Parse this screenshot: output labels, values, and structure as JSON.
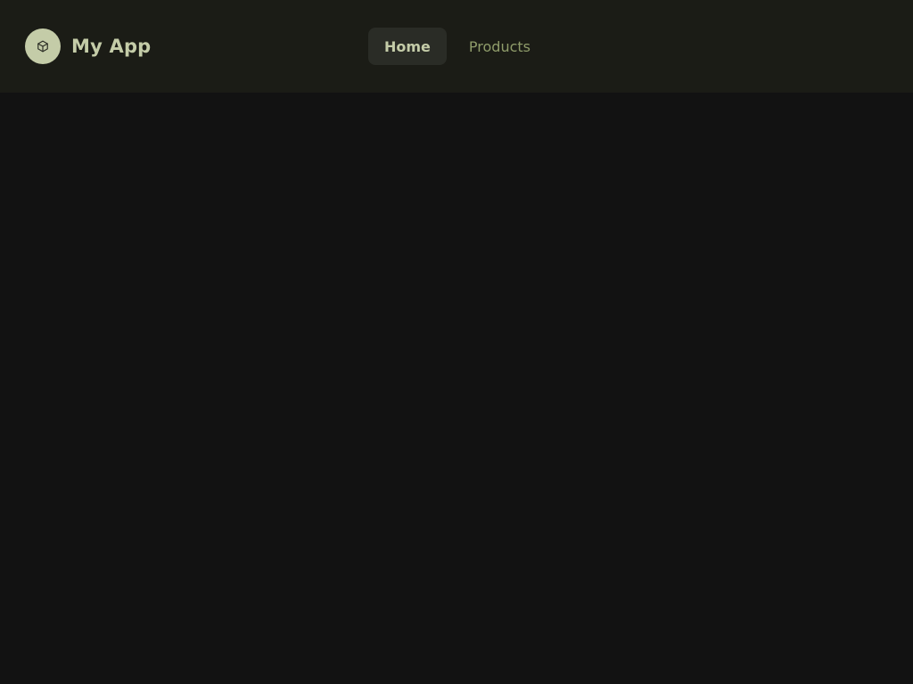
{
  "app": {
    "title": "My App",
    "logo_icon": "cube-icon"
  },
  "nav": {
    "items": [
      {
        "label": "Home",
        "active": true
      },
      {
        "label": "Products",
        "active": false
      }
    ]
  },
  "colors": {
    "header_bg": "#1b1c16",
    "page_bg": "#121212",
    "accent": "#c4cca8",
    "muted_link": "#8f9c6a",
    "active_pill": "#2a2c26"
  }
}
